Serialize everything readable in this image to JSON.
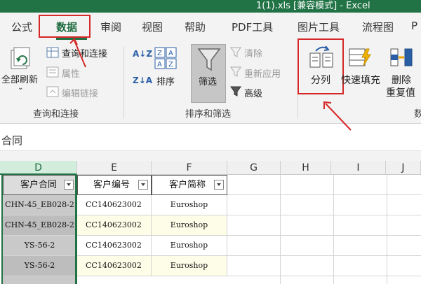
{
  "title": "1(1).xls  [兼容模式]   -   Excel",
  "tabs": [
    "公式",
    "数据",
    "审阅",
    "视图",
    "帮助",
    "PDF工具",
    "图片工具",
    "流程图",
    "P"
  ],
  "ribbon": {
    "refresh_all": "全部刷新",
    "query_connect": "查询和连接",
    "properties": "属性",
    "edit_links": "编辑链接",
    "group_query": "查询和连接",
    "sort_asc": "A↓Z",
    "sort_desc": "Z↓A",
    "sort": "排序",
    "filter": "筛选",
    "clear": "清除",
    "reapply": "重新应用",
    "advanced": "高级",
    "group_sort": "排序和筛选",
    "split": "分列",
    "flash_fill": "快速填充",
    "remove_dup_1": "删除",
    "remove_dup_2": "重复值",
    "group_tools_partial": "数"
  },
  "formula_bar": {
    "content": "合同"
  },
  "columns": [
    "D",
    "E",
    "F",
    "G",
    "H",
    "I",
    "J"
  ],
  "table": {
    "headers": [
      "客户合同",
      "客户编号",
      "客户简称"
    ],
    "rows": [
      [
        "CHN-45_EB028-2",
        "CC140623002",
        "Euroshop"
      ],
      [
        "CHN-45_EB028-2",
        "CC140623002",
        "Euroshop"
      ],
      [
        "YS-56-2",
        "CC140623002",
        "Euroshop"
      ],
      [
        "YS-56-2",
        "CC140623002",
        "Euroshop"
      ]
    ]
  },
  "colors": {
    "excel_green": "#217346",
    "annotation_red": "#d62828",
    "row_highlight": "#fefde8"
  }
}
